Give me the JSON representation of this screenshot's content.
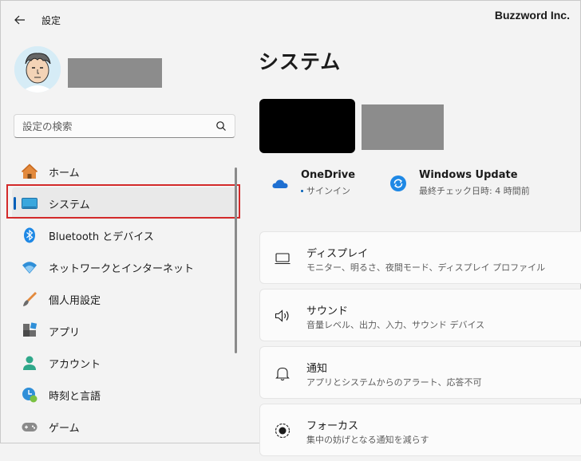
{
  "app": {
    "title": "設定",
    "watermark": "Buzzword Inc."
  },
  "search": {
    "placeholder": "設定の検索"
  },
  "sidebar": {
    "items": [
      {
        "label": "ホーム",
        "icon": "home-icon"
      },
      {
        "label": "システム",
        "icon": "system-icon",
        "selected": true
      },
      {
        "label": "Bluetooth とデバイス",
        "icon": "bluetooth-icon"
      },
      {
        "label": "ネットワークとインターネット",
        "icon": "network-icon"
      },
      {
        "label": "個人用設定",
        "icon": "personalization-icon"
      },
      {
        "label": "アプリ",
        "icon": "apps-icon"
      },
      {
        "label": "アカウント",
        "icon": "account-icon"
      },
      {
        "label": "時刻と言語",
        "icon": "time-language-icon"
      },
      {
        "label": "ゲーム",
        "icon": "gaming-icon"
      }
    ]
  },
  "main": {
    "title": "システム",
    "services": {
      "onedrive": {
        "title": "OneDrive",
        "status": "サインイン"
      },
      "windows_update": {
        "title": "Windows Update",
        "status": "最終チェック日時: 4 時間前"
      }
    },
    "cards": [
      {
        "title": "ディスプレイ",
        "desc": "モニター、明るさ、夜間モード、ディスプレイ プロファイル",
        "icon": "display-icon"
      },
      {
        "title": "サウンド",
        "desc": "音量レベル、出力、入力、サウンド デバイス",
        "icon": "sound-icon"
      },
      {
        "title": "通知",
        "desc": "アプリとシステムからのアラート、応答不可",
        "icon": "notification-icon"
      },
      {
        "title": "フォーカス",
        "desc": "集中の妨げとなる通知を減らす",
        "icon": "focus-icon"
      }
    ]
  },
  "colors": {
    "accent": "#005fb8",
    "highlight": "#d32a2a",
    "background": "#f3f3f3"
  }
}
